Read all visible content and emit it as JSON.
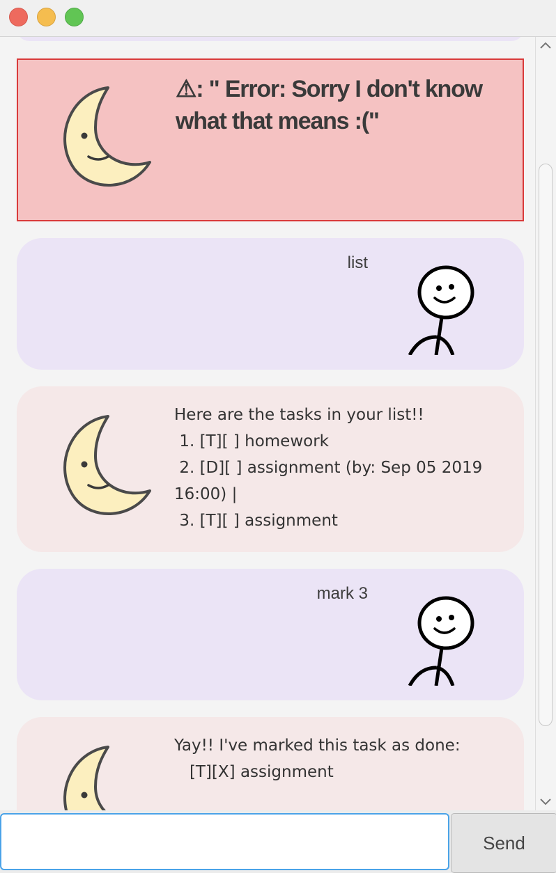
{
  "window": {
    "controls": [
      "close",
      "minimize",
      "maximize"
    ],
    "colors": {
      "close": "#ee6a5e",
      "minimize": "#f5bd4f",
      "maximize": "#61c554"
    }
  },
  "colors": {
    "error_background": "#f5c2c2",
    "error_border": "#d93a3a",
    "user_bubble": "#ebe4f6",
    "bot_bubble": "#f5e8e8",
    "moon_fill": "#fcefbf",
    "input_focus": "#4aa3e8"
  },
  "icons": {
    "bot_avatar": "moon-face-icon",
    "user_avatar": "stick-figure-icon",
    "warning": "warning-icon"
  },
  "messages": [
    {
      "sender": "bot",
      "style": "error",
      "text": "⚠: \" Error: Sorry I don't know what that means :(\""
    },
    {
      "sender": "user",
      "text": "list"
    },
    {
      "sender": "bot",
      "text": "Here are the tasks in your list!!\n 1. [T][ ] homework\n 2. [D][ ] assignment (by: Sep 05 2019 16:00) |\n 3. [T][ ] assignment"
    },
    {
      "sender": "user",
      "text": "mark 3"
    },
    {
      "sender": "bot",
      "text": "Yay!! I've marked this task as done:\n   [T][X] assignment"
    }
  ],
  "input": {
    "value": "",
    "placeholder": ""
  },
  "send_label": "Send"
}
